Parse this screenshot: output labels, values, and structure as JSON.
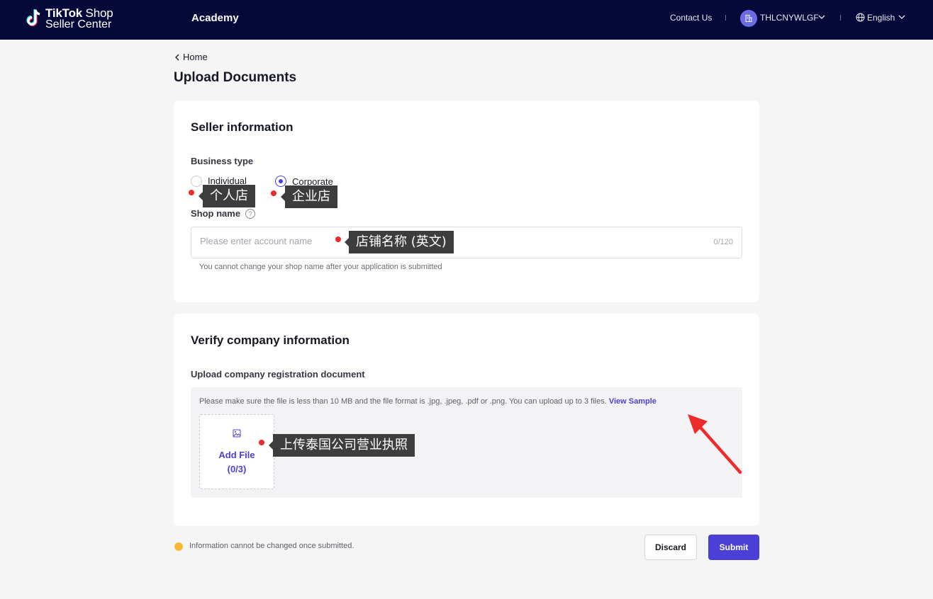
{
  "nav": {
    "brand_line1_bold": "TikTok",
    "brand_line1_rest": " Shop",
    "brand_line2": "Seller Center",
    "academy": "Academy",
    "contact": "Contact Us",
    "account": "THLCNYWLGF",
    "language": "English"
  },
  "header": {
    "back": "Home",
    "title": "Upload Documents"
  },
  "seller": {
    "title": "Seller information",
    "business_type_label": "Business type",
    "options": [
      "Individual",
      "Corporate"
    ],
    "selected": "Corporate",
    "shop_name_label": "Shop name",
    "help_glyph": "?",
    "shop_name_placeholder": "Please enter account name",
    "shop_name_value": "",
    "counter": "0/120",
    "hint": "You cannot change your shop name after your application is submitted"
  },
  "company": {
    "title": "Verify company information",
    "upload_label": "Upload company registration document",
    "note": "Please make sure the file is less than 10 MB and the file format is .jpg, .jpeg, .pdf or .png. You can upload up to 3 files.",
    "view_sample": "View Sample",
    "add_file": "Add File",
    "add_file_count": "(0/3)"
  },
  "footer": {
    "warning": "Information cannot be changed once submitted.",
    "discard": "Discard",
    "submit": "Submit"
  },
  "annotations": {
    "individual": "个人店",
    "corporate": "企业店",
    "shop_name": "店铺名称 (英文)",
    "upload": "上传泰国公司营业执照"
  },
  "colors": {
    "nav_bg": "#05093a",
    "accent": "#4b3fd6",
    "annotation_red": "#ee2b2b",
    "warning": "#f5b935"
  }
}
